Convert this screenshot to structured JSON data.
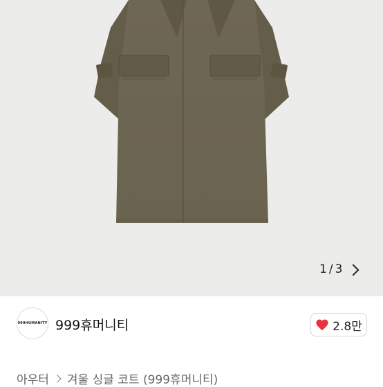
{
  "gallery": {
    "image_description_icon": "coat-photo",
    "pager_current": "1",
    "pager_separator": "/",
    "pager_total": "3",
    "next_icon": "chevron-right-icon",
    "colors": {
      "background": "#ececeb",
      "coat": "#6b6450"
    }
  },
  "seller": {
    "avatar_text": "999HUMANITY",
    "name": "999휴머니티"
  },
  "like": {
    "icon": "heart-icon",
    "count": "2.8만",
    "color": "#e8323c"
  },
  "breadcrumb": {
    "category": "아우터",
    "title": "겨울 싱글 코트 (999휴머니티)"
  }
}
